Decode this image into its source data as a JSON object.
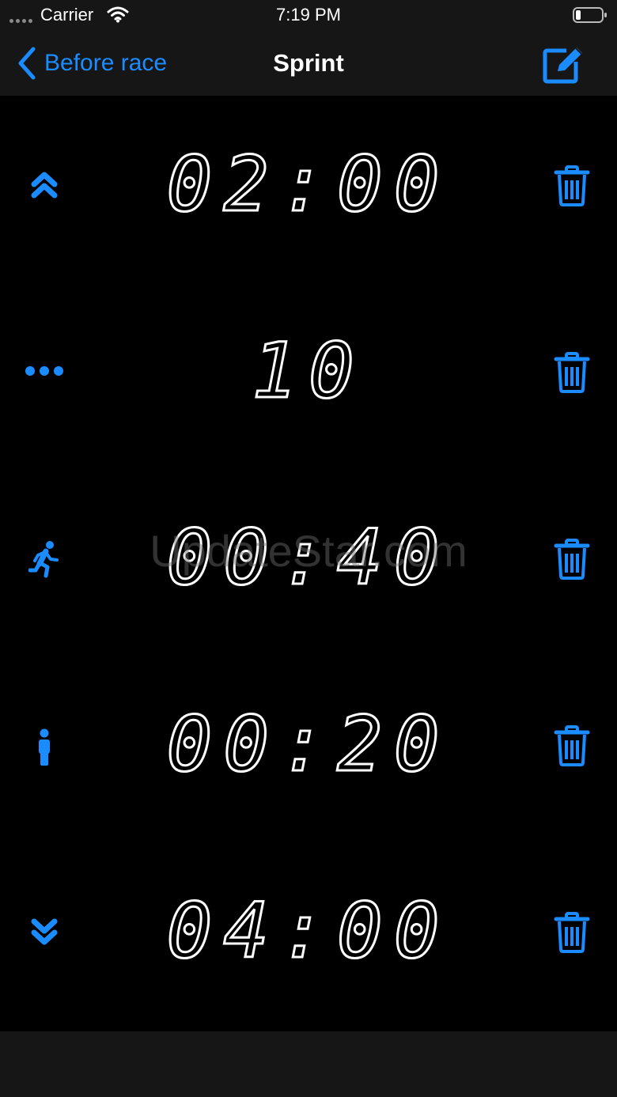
{
  "status_bar": {
    "carrier": "Carrier",
    "time": "7:19 PM"
  },
  "nav": {
    "back_label": "Before race",
    "title": "Sprint",
    "edit_icon": "compose-icon"
  },
  "rows": [
    {
      "icon": "double-chevron-up-icon",
      "value": "02:00"
    },
    {
      "icon": "ellipsis-icon",
      "value": "10"
    },
    {
      "icon": "running-person-icon",
      "value": "00:40"
    },
    {
      "icon": "standing-person-icon",
      "value": "00:20"
    },
    {
      "icon": "double-chevron-down-icon",
      "value": "04:00"
    }
  ],
  "row_action_icon": "trash-icon",
  "watermark": "UpdateStar.com",
  "colors": {
    "accent": "#1a8cff",
    "background": "#000000",
    "bar_background": "#161616",
    "digits": "#ffffff"
  }
}
